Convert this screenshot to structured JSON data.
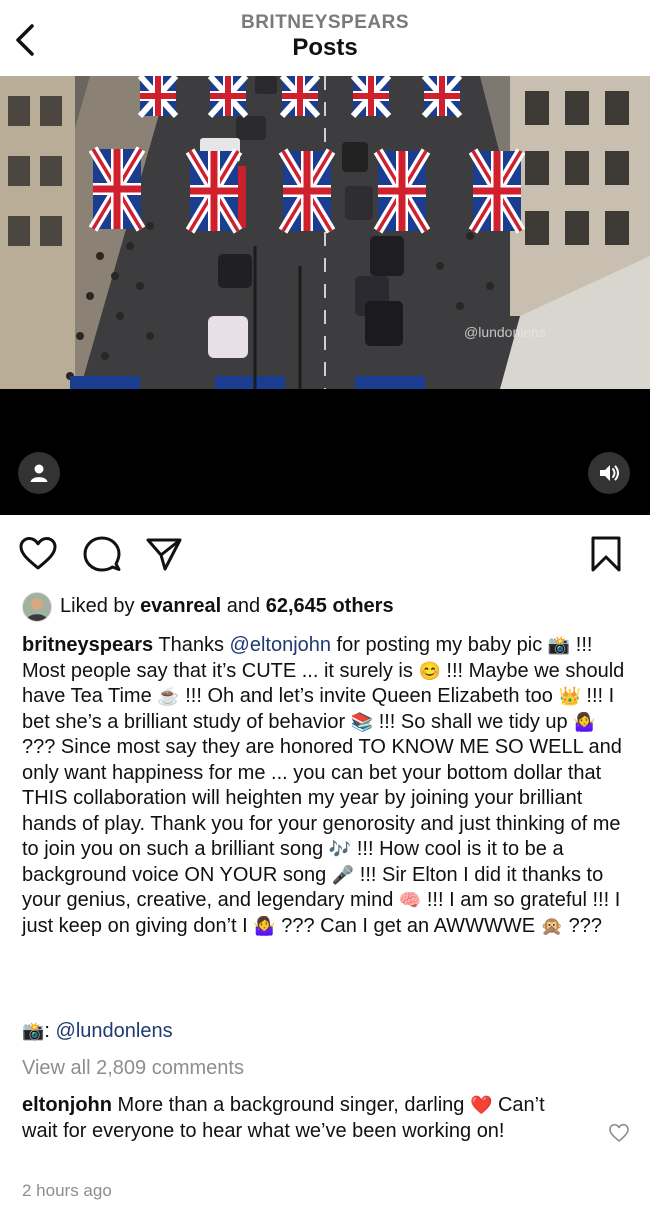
{
  "header": {
    "username": "BRITNEYSPEARS",
    "title": "Posts"
  },
  "media": {
    "watermark": "@lundonlens"
  },
  "likes": {
    "prefix": "Liked by",
    "user": "evanreal",
    "middle": "and",
    "count": "62,645 others"
  },
  "caption": {
    "author": "britneyspears",
    "t1": " Thanks ",
    "mention1": "@eltonjohn",
    "t2": " for posting my baby pic ",
    "e_camera": "📸",
    "t3": " !!! Most people say that it’s CUTE ... it surely is ",
    "e_smile": "😊",
    "t4": " !!! Maybe we should have Tea Time ",
    "e_tea": "☕",
    "t5": " !!! Oh and let’s invite Queen Elizabeth too ",
    "e_crown": "👑",
    "t6": " !!! I bet she’s a brilliant study of behavior ",
    "e_books": "📚",
    "t7": " !!! So shall we tidy up ",
    "e_shrug1": "🤷‍♀️",
    "t8": " ??? Since most say they are honored TO KNOW ME SO WELL and only want happiness for me ... you can bet your bottom dollar that THIS collaboration will heighten my year by joining your brilliant hands of play. Thank you for your genorosity and just thinking of me to join you on such a brilliant song ",
    "e_notes": "🎶",
    "t9": " !!! How cool is it to be a background voice ON YOUR song ",
    "e_mic": "🎤",
    "t10": " !!! Sir Elton I did it thanks to your genius, creative, and legendary mind ",
    "e_brain": "🧠",
    "t11": " !!! I am so grateful !!! I just keep on giving don’t I ",
    "e_shrug2": "🤷‍♀️",
    "t12": " ??? Can I get an AWWWWE ",
    "e_monkey": "🙊",
    "t13": " ???"
  },
  "credit": {
    "icon": "📸",
    "sep": ":",
    "mention": "@lundonlens"
  },
  "comments_link": "View all 2,809 comments",
  "top_comment": {
    "author": "eltonjohn",
    "text": " More than a background singer, darling ",
    "emoji": "❤️",
    "text2": " Can’t wait for everyone to hear what we’ve been working on!"
  },
  "timestamp": "2 hours ago",
  "icons": [
    "chevron-left-icon",
    "user-tag-icon",
    "speaker-icon",
    "heart-icon",
    "comment-icon",
    "share-icon",
    "bookmark-icon"
  ],
  "colors": {
    "mention": "#1f3a73",
    "muted": "#8e8e8e"
  }
}
